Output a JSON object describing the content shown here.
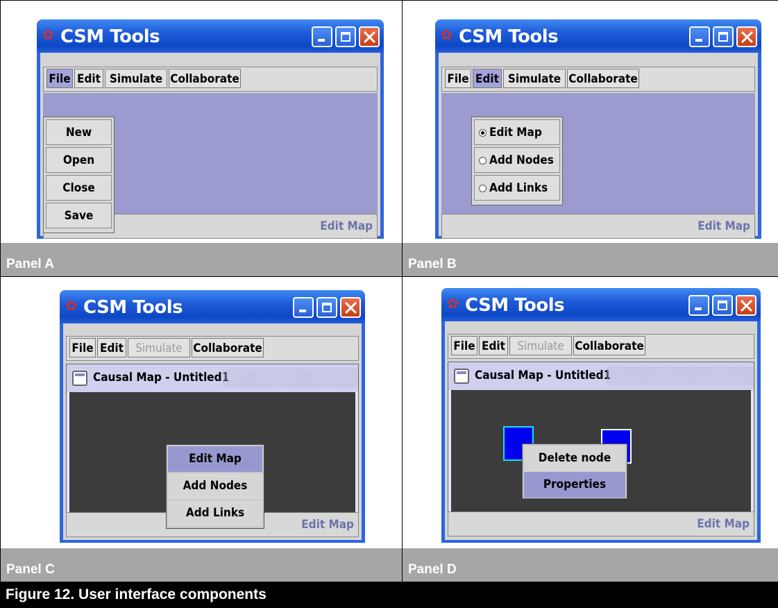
{
  "window": {
    "title": "CSM Tools"
  },
  "menus": {
    "file": "File",
    "edit": "Edit",
    "simulate": "Simulate",
    "collaborate": "Collaborate"
  },
  "status": "Edit Map",
  "panel_a": {
    "label": "Panel A",
    "file_items": [
      "New",
      "Open",
      "Close",
      "Save"
    ]
  },
  "panel_b": {
    "label": "Panel B",
    "edit_items": [
      "Edit Map",
      "Add Nodes",
      "Add Links"
    ],
    "selected_index": 0
  },
  "panel_c": {
    "label": "Panel C",
    "internal_title": "Causal Map - Untitled1",
    "popup_items": [
      "Edit Map",
      "Add Nodes",
      "Add Links"
    ]
  },
  "panel_d": {
    "label": "Panel D",
    "internal_title": "Causal Map - Untitled1",
    "popup_items": [
      "Delete node",
      "Properties"
    ]
  },
  "caption": "Figure 12.  User interface components",
  "colors": {
    "title_blue": "#2c66e0",
    "desktop": "#9b9bcf",
    "canvas": "#3c3c3c",
    "node": "#0000f0",
    "highlight": "#9898d0",
    "panel_label_bg": "#a6a6a6"
  }
}
